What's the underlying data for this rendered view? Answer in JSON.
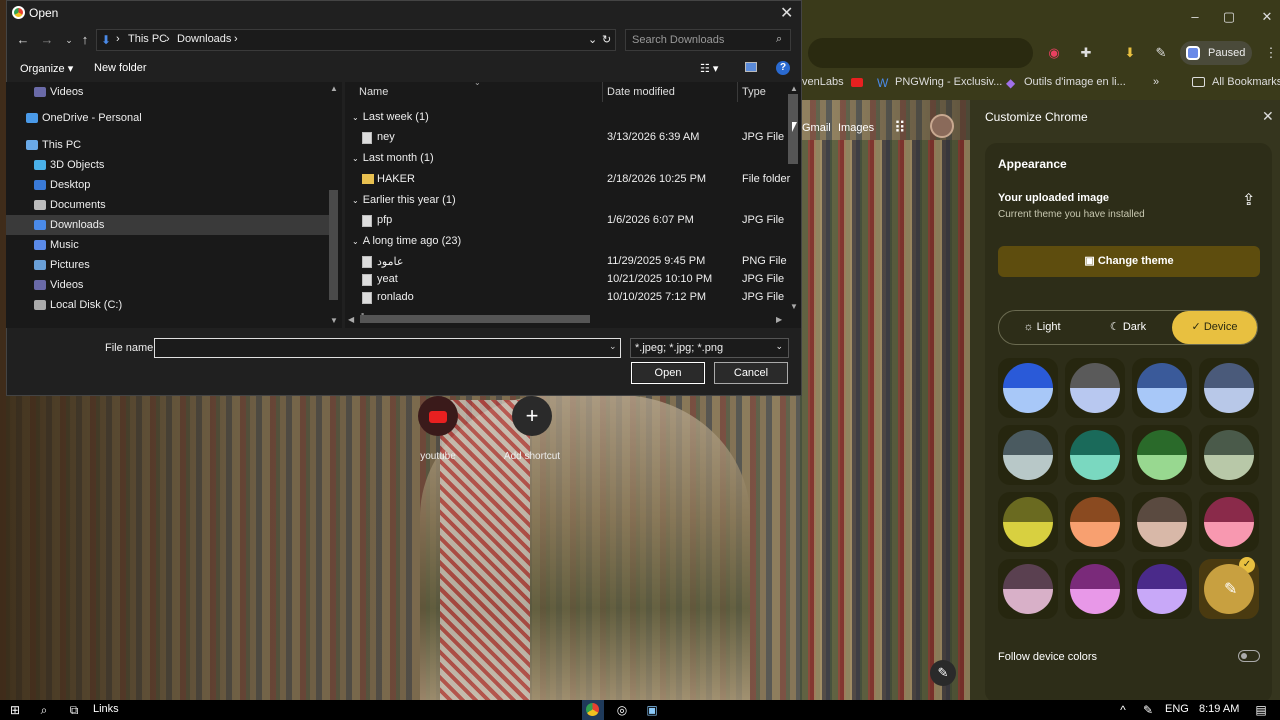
{
  "dialog": {
    "title": "Open",
    "breadcrumb": [
      "This PC",
      "Downloads"
    ],
    "search_placeholder": "Search Downloads",
    "toolbar": {
      "organize": "Organize ▾",
      "new_folder": "New folder"
    },
    "nav_items": [
      {
        "label": "Videos",
        "indent": 1
      },
      {
        "label": "OneDrive - Personal",
        "indent": 0
      },
      {
        "label": "This PC",
        "indent": 0
      },
      {
        "label": "3D Objects",
        "indent": 1
      },
      {
        "label": "Desktop",
        "indent": 1
      },
      {
        "label": "Documents",
        "indent": 1
      },
      {
        "label": "Downloads",
        "indent": 1,
        "selected": true
      },
      {
        "label": "Music",
        "indent": 1
      },
      {
        "label": "Pictures",
        "indent": 1
      },
      {
        "label": "Videos",
        "indent": 1
      },
      {
        "label": "Local Disk (C:)",
        "indent": 1
      }
    ],
    "columns": {
      "name": "Name",
      "date": "Date modified",
      "type": "Type"
    },
    "groups": [
      {
        "label": "Last week (1)",
        "files": [
          {
            "name": "ney",
            "date": "3/13/2026 6:39 AM",
            "type": "JPG File",
            "icon": "image-file-icon"
          }
        ]
      },
      {
        "label": "Last month (1)",
        "files": [
          {
            "name": "HAKER",
            "date": "2/18/2026 10:25 PM",
            "type": "File folder",
            "icon": "folder-icon"
          }
        ]
      },
      {
        "label": "Earlier this year (1)",
        "files": [
          {
            "name": "pfp",
            "date": "1/6/2026 6:07 PM",
            "type": "JPG File",
            "icon": "image-file-icon"
          }
        ]
      },
      {
        "label": "A long time ago (23)",
        "files": [
          {
            "name": "عامود",
            "date": "11/29/2025 9:45 PM",
            "type": "PNG File",
            "icon": "image-file-icon"
          },
          {
            "name": "yeat",
            "date": "10/21/2025 10:10 PM",
            "type": "JPG File",
            "icon": "image-file-icon"
          },
          {
            "name": "ronlado",
            "date": "10/10/2025 7:12 PM",
            "type": "JPG File",
            "icon": "image-file-icon"
          }
        ]
      }
    ],
    "file_name_label": "File name:",
    "file_name_value": "",
    "file_type": "*.jpeg; *.jpg; *.png",
    "open_label": "Open",
    "cancel_label": "Cancel"
  },
  "browser": {
    "paused_label": "Paused",
    "bookmarks": [
      "venLabs",
      "PNGWing - Exclusiv...",
      "Outils d'image en li...",
      "All Bookmarks"
    ],
    "ntp_links": [
      "Gmail",
      "Images"
    ],
    "shortcuts": [
      {
        "label": "youtube"
      },
      {
        "label": "Add shortcut"
      }
    ]
  },
  "customize": {
    "title": "Customize Chrome",
    "appearance": "Appearance",
    "uploaded_title": "Your uploaded image",
    "uploaded_sub": "Current theme you have installed",
    "change_theme": "Change theme",
    "modes": [
      "Light",
      "Dark",
      "Device"
    ],
    "follow_device": "Follow device colors",
    "swatches": [
      [
        "#2a5ad8",
        "#a8c8f8"
      ],
      [
        "#5a5a5a",
        "#b8c8f0"
      ],
      [
        "#3a5a9a",
        "#a8c8f8"
      ],
      [
        "#4a5a7a",
        "#b8c8e8"
      ],
      [
        "#4a5a60",
        "#b8c8c8"
      ],
      [
        "#1a6a5a",
        "#7ad8c0"
      ],
      [
        "#2a6a2a",
        "#98d890"
      ],
      [
        "#4a5a4a",
        "#b8c8a8"
      ],
      [
        "#6a6a20",
        "#d8d040"
      ],
      [
        "#8a4a20",
        "#f8a070"
      ],
      [
        "#5a4a40",
        "#d8b8a8"
      ],
      [
        "#8a2a4a",
        "#f898b0"
      ],
      [
        "#5a4050",
        "#d8b0c8"
      ],
      [
        "#7a2a7a",
        "#e898e8"
      ],
      [
        "#4a2a8a",
        "#c8a8f8"
      ],
      [
        "#7a6a20",
        "#c8a040"
      ]
    ]
  },
  "taskbar": {
    "links": "Links",
    "lang": "ENG",
    "time": "8:19 AM"
  }
}
